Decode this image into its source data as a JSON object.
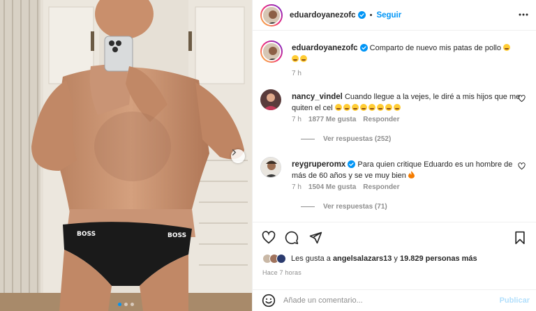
{
  "post": {
    "username": "eduardoyanezofc",
    "follow_label": "Seguir",
    "caption_user": "eduardoyanezofc",
    "caption_text": "Comparto de nuevo mis patas de pollo",
    "caption_time": "7 h",
    "carousel": {
      "current_slide": 1,
      "total_slides": 3
    }
  },
  "comments": [
    {
      "user": "nancy_vindel",
      "text": "Cuando llegue a la vejes, le diré a mis hijos que me quiten el cel",
      "time": "7 h",
      "likes": "1877 Me gusta",
      "reply_label": "Responder",
      "view_replies": "Ver respuestas (252)"
    },
    {
      "user": "reygruperomx",
      "text": "Para quien critique Eduardo es un hombre de más de 60 años y se ve muy bien",
      "time": "7 h",
      "likes": "1504 Me gusta",
      "reply_label": "Responder",
      "view_replies": "Ver respuestas (71)"
    }
  ],
  "likes": {
    "prefix": "Les gusta a",
    "user": "angelsalazars13",
    "connector": "y",
    "others": "19.829 personas más"
  },
  "timestamp": "Hace 7 horas",
  "add_comment": {
    "placeholder": "Añade un comentario...",
    "publish_label": "Publicar"
  },
  "colors": {
    "accent": "#0095f6",
    "publish_disabled": "#b2dffc",
    "secondary_text": "#8e8e8e"
  },
  "icons": [
    "verified-badge-icon",
    "more-options-icon",
    "heart-icon",
    "comment-icon",
    "share-icon",
    "bookmark-icon",
    "emoji-icon",
    "chevron-right-icon"
  ]
}
